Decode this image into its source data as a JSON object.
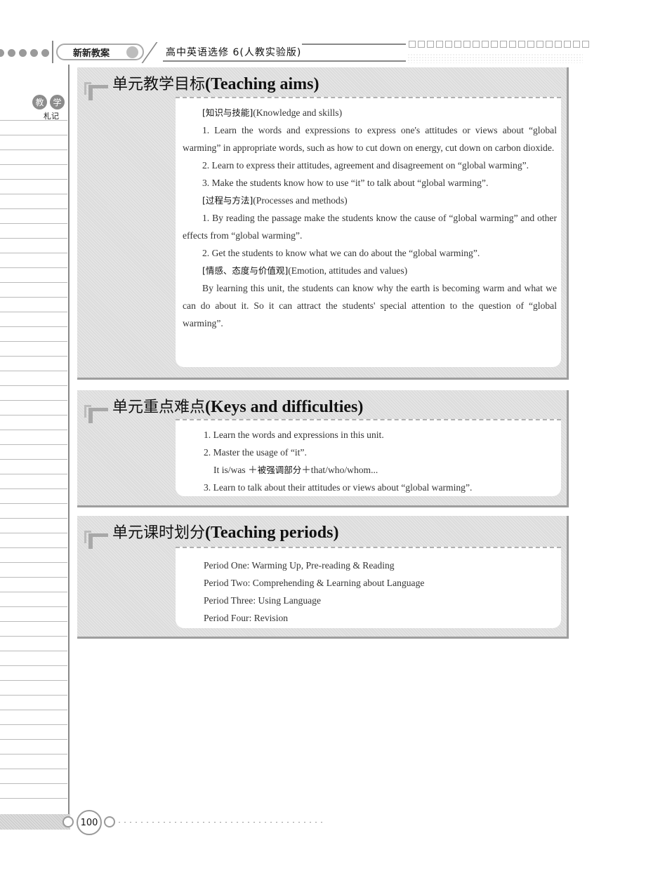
{
  "header": {
    "series_name": "新新教案",
    "book_title": "高中英语选修 6(人教实验版)"
  },
  "margin": {
    "badge_chars": [
      "教",
      "学"
    ],
    "label": "札记"
  },
  "sections": [
    {
      "title_zh": "单元教学目标",
      "title_en": "(Teaching aims)",
      "paragraphs": [
        {
          "type": "heading",
          "zh": "[知识与技能]",
          "en": "(Knowledge and skills)"
        },
        {
          "type": "text",
          "text": "1. Learn the words and expressions to express one's attitudes or views about “global warming” in appropriate words, such as how to cut down on energy, cut down on carbon dioxide."
        },
        {
          "type": "text",
          "text": "2. Learn to express their attitudes, agreement and disagreement on “global warming”."
        },
        {
          "type": "text",
          "text": "3. Make the students know how to use “it” to talk about “global warming”."
        },
        {
          "type": "heading",
          "zh": "[过程与方法]",
          "en": "(Processes and methods)"
        },
        {
          "type": "text",
          "text": "1. By reading the passage make the students know the cause of “global warming” and other effects from “global warming”."
        },
        {
          "type": "text",
          "text": "2. Get the students to know what we can do about the “global warming”."
        },
        {
          "type": "heading",
          "zh": "[情感、态度与价值观]",
          "en": "(Emotion, attitudes and values)"
        },
        {
          "type": "text",
          "text": "By learning this unit, the students can know why the earth is becoming warm and what we can do about it. So it can attract the students' special attention to the question of “global warming”."
        }
      ]
    },
    {
      "title_zh": "单元重点难点",
      "title_en": "(Keys and difficulties)",
      "items": [
        {
          "text": "1. Learn the words and expressions in this unit."
        },
        {
          "text": "2. Master the usage of “it”."
        },
        {
          "pre": "It is/was ＋",
          "zh": "被强调部分",
          "post": "＋that/who/whom..."
        },
        {
          "text": "3. Learn to talk about their attitudes or views about “global warming”."
        }
      ]
    },
    {
      "title_zh": "单元课时划分",
      "title_en": "(Teaching periods)",
      "items": [
        "Period One: Warming Up, Pre-reading & Reading",
        "Period Two: Comprehending & Learning about Language",
        "Period Three: Using Language",
        "Period Four: Revision"
      ]
    }
  ],
  "footer": {
    "page_number": "100"
  }
}
